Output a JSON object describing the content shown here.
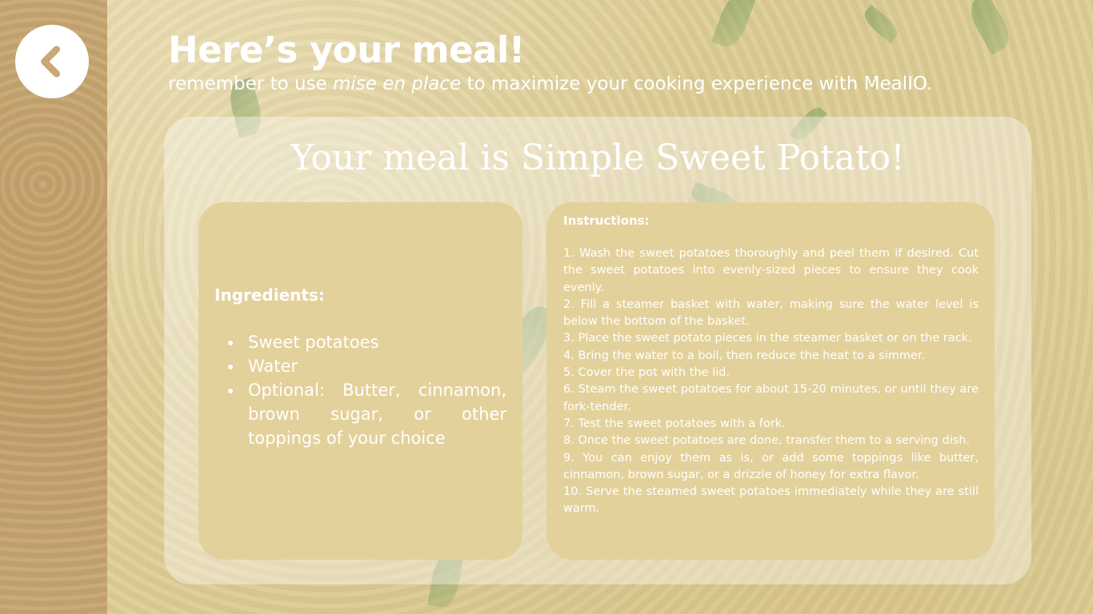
{
  "header": {
    "back_icon": "chevron-left-icon",
    "title": "Here’s your meal!",
    "subtitle_before": "remember to use ",
    "subtitle_emphasis": "mise en place",
    "subtitle_after": " to maximize your cooking experience with MealIO."
  },
  "meal": {
    "title": "Your meal is Simple Sweet Potato!"
  },
  "ingredients": {
    "heading": "Ingredients:",
    "items": [
      "Sweet potatoes",
      "Water",
      "Optional: Butter, cinnamon, brown sugar, or other toppings of your choice"
    ]
  },
  "instructions": {
    "heading": "Instructions:",
    "steps": [
      "1. Wash the sweet potatoes thoroughly and peel them if desired. Cut the sweet potatoes into evenly-sized pieces to ensure they cook evenly.",
      "2. Fill a steamer basket with water, making sure the water level is below the bottom of the basket.",
      "3. Place the sweet potato pieces in the steamer basket or on the rack.",
      "4. Bring the water to a boil, then reduce the heat to a simmer.",
      "5. Cover the pot with the lid.",
      "6. Steam the sweet potatoes for about 15-20 minutes, or until they are fork-tender.",
      "7. Test the sweet potatoes with a fork.",
      "8. Once the sweet potatoes are done, transfer them to a serving dish.",
      "9. You can enjoy them as is, or add some toppings like butter, cinnamon, brown sugar, or a drizzle of honey for extra flavor.",
      "10. Serve the steamed sweet potatoes immediately while they are still warm."
    ]
  },
  "colors": {
    "background": "#e3d29b",
    "left_strip": "#c6a470",
    "panel": "#e3d19c",
    "text": "#ffffff",
    "back_chevron": "#c9a874"
  }
}
